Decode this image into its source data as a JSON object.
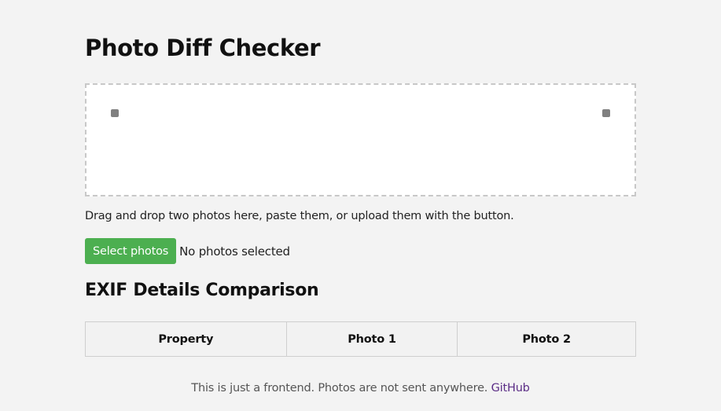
{
  "header": {
    "title": "Photo Diff Checker"
  },
  "dropzone": {
    "instructions": "Drag and drop two photos here, paste them, or upload them with the button."
  },
  "upload": {
    "button_label": "Select photos",
    "status": "No photos selected"
  },
  "exif": {
    "title": "EXIF Details Comparison",
    "columns": [
      "Property",
      "Photo 1",
      "Photo 2"
    ]
  },
  "footer": {
    "text": "This is just a frontend. Photos are not sent anywhere.",
    "link_label": "GitHub"
  },
  "colors": {
    "accent": "#4caf50",
    "link": "#5b2d86",
    "background": "#f3f3f3"
  }
}
